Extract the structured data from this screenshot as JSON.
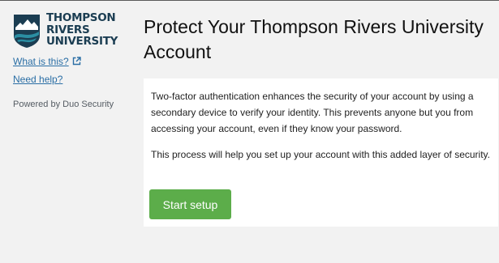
{
  "sidebar": {
    "logo": {
      "line1": "THOMPSON",
      "line2": "RIVERS",
      "line3": "UNIVERSITY",
      "colors": {
        "navy": "#1b3d52",
        "teal": "#2b8ea3"
      }
    },
    "what_is_this": "What is this?",
    "need_help": "Need help?",
    "powered_by": "Powered by Duo Security"
  },
  "main": {
    "title": "Protect Your Thompson Rivers University Account",
    "paragraph1": "Two-factor authentication enhances the security of your account by using a secondary device to verify your identity. This prevents anyone but you from accessing your account, even if they know your password.",
    "paragraph2": "This process will help you set up your account with this added layer of security.",
    "start_button": "Start setup"
  },
  "colors": {
    "background": "#f2f2f2",
    "link": "#2a6ea5",
    "button": "#5cad4a"
  },
  "icons": {
    "external_link": "external-link-icon"
  }
}
